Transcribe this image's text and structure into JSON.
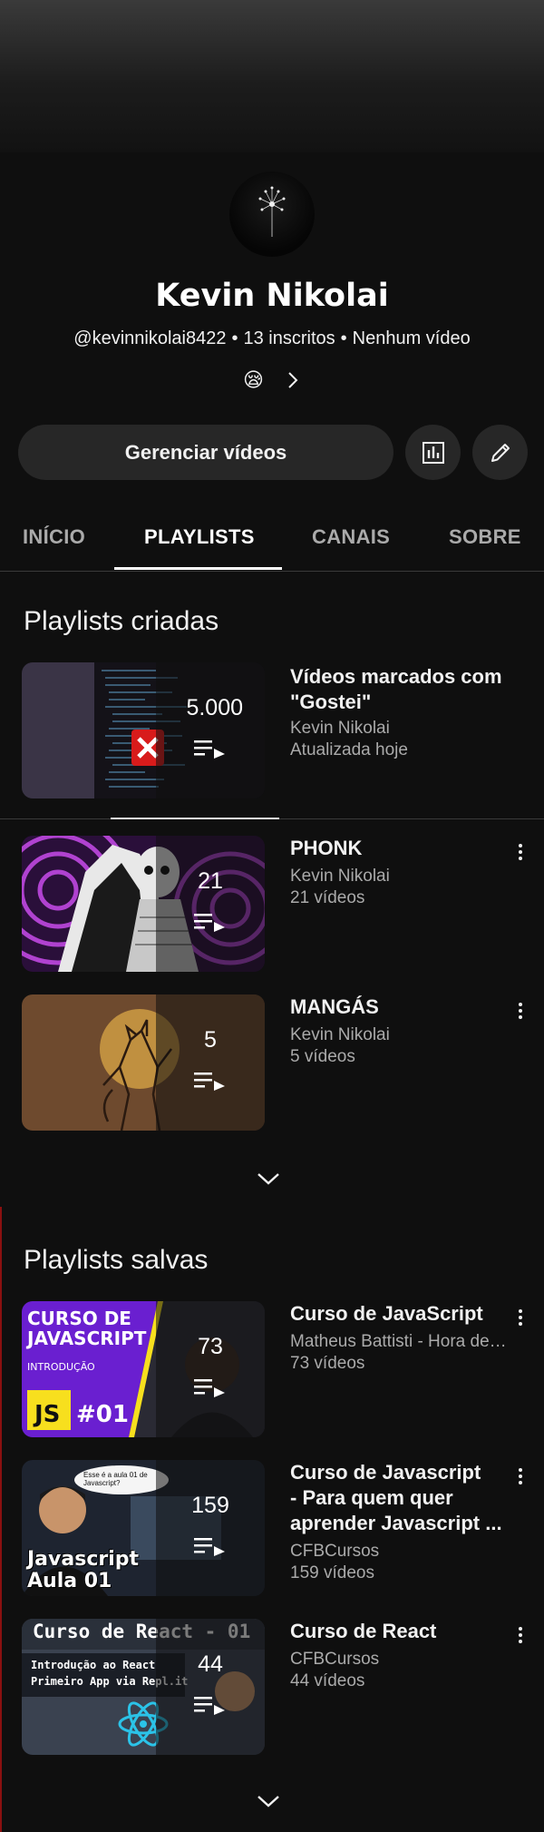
{
  "channel": {
    "name": "Kevin Nikolai",
    "handle": "@kevinnikolai8422",
    "subscribers": "13 inscritos",
    "videos": "Nenhum vídeo",
    "separator": "•",
    "status_emoji": "😪"
  },
  "actions": {
    "manage_label": "Gerenciar vídeos"
  },
  "tabs": [
    {
      "label": "INÍCIO",
      "active": false
    },
    {
      "label": "PLAYLISTS",
      "active": true
    },
    {
      "label": "CANAIS",
      "active": false
    },
    {
      "label": "SOBRE",
      "active": false
    }
  ],
  "created": {
    "title": "Playlists criadas",
    "items": [
      {
        "title_line1": "Vídeos marcados com",
        "title_line2": "\"Gostei\"",
        "channel": "Kevin Nikolai",
        "meta": "Atualizada hoje",
        "count": "5.000"
      },
      {
        "title": "PHONK",
        "channel": "Kevin Nikolai",
        "meta": "21 vídeos",
        "count": "21"
      },
      {
        "title": "MANGÁS",
        "channel": "Kevin Nikolai",
        "meta": "5 vídeos",
        "count": "5"
      }
    ]
  },
  "saved": {
    "title": "Playlists salvas",
    "items": [
      {
        "title": "Curso de JavaScript",
        "channel": "Matheus Battisti - Hora de Codar",
        "meta": "73 vídeos",
        "count": "73",
        "thumb_text": {
          "line1": "CURSO DE",
          "line2": "JAVASCRIPT",
          "line3": "INTRODUÇÃO",
          "badge": "JS",
          "num": "#01"
        }
      },
      {
        "title_line1": "Curso de Javascript",
        "title_line2": "- Para quem quer",
        "title_line3": "aprender Javascript ...",
        "channel": "CFBCursos",
        "meta": "159 vídeos",
        "count": "159",
        "thumb_text": {
          "line1": "Javascript",
          "line2": "Aula 01",
          "bubble": "Esse é a aula 01 de Javascript?"
        }
      },
      {
        "title": "Curso de React",
        "channel": "CFBCursos",
        "meta": "44 vídeos",
        "count": "44",
        "thumb_text": {
          "line1": "Curso de React - 01",
          "line2": "Introdução ao React",
          "line3": "Primeiro App via Repl.it"
        }
      }
    ]
  },
  "colors": {
    "background": "#0f0f0f",
    "chip": "#272727",
    "secondary_text": "#aaaaaa"
  }
}
